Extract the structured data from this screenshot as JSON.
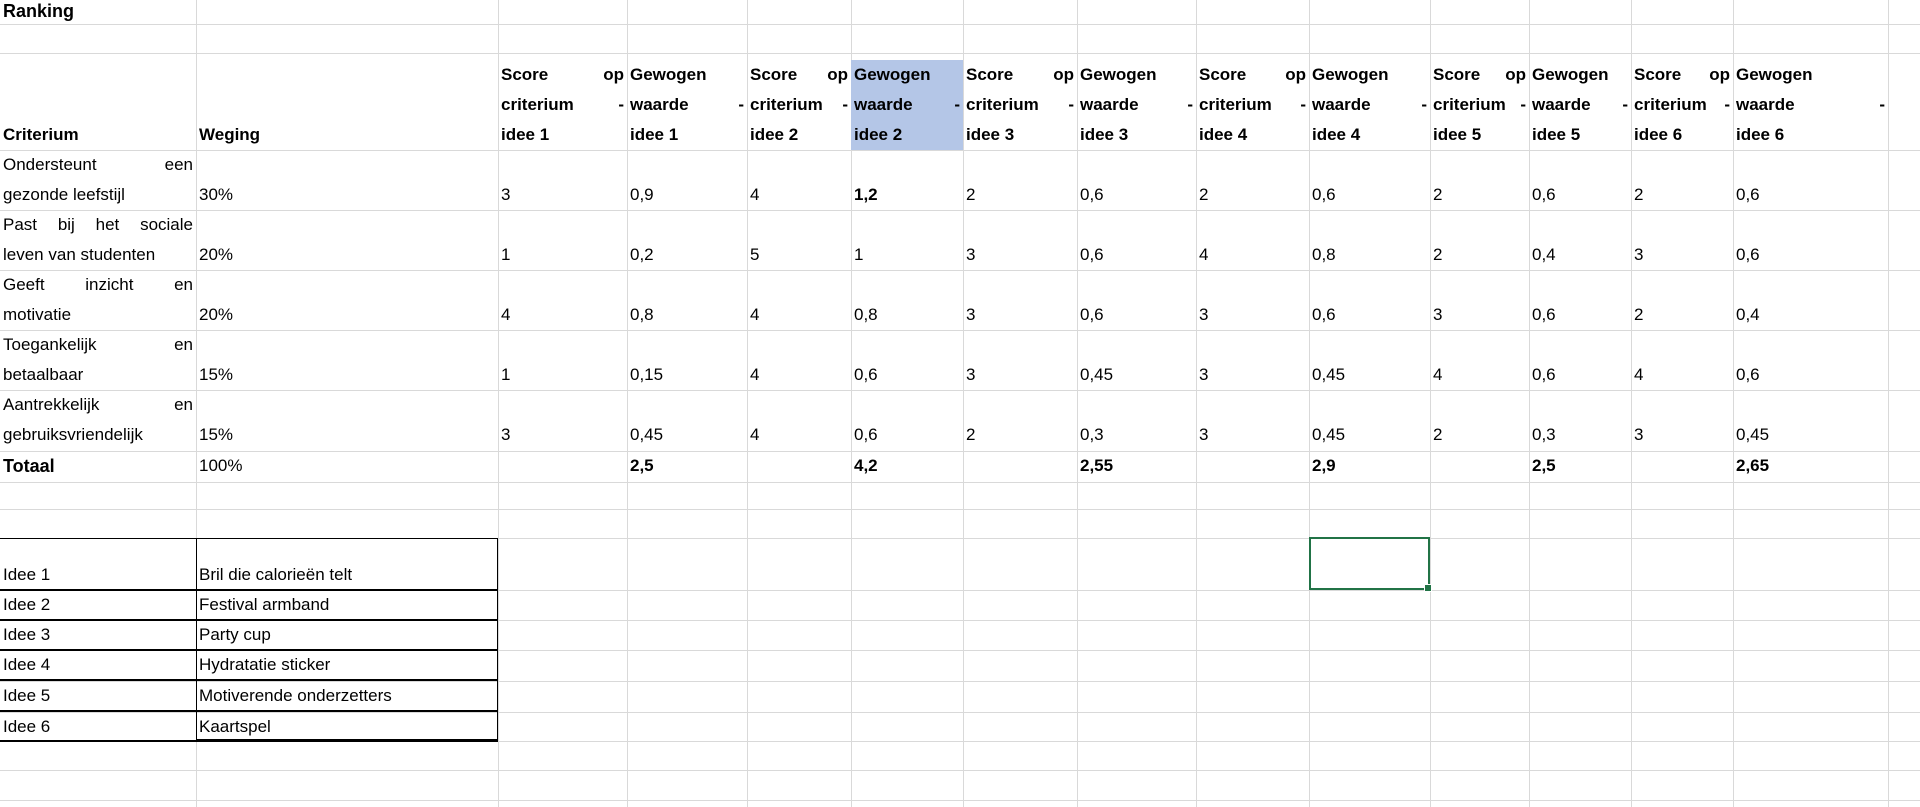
{
  "title": "Ranking",
  "columns": {
    "criterium": "Criterium",
    "weging": "Weging",
    "ideas": [
      {
        "score_header": "Score op criterium - idee 1",
        "weighted_header": "Gewogen waarde - idee 1"
      },
      {
        "score_header": "Score op criterium - idee 2",
        "weighted_header": "Gewogen waarde - idee 2"
      },
      {
        "score_header": "Score op criterium - idee 3",
        "weighted_header": "Gewogen waarde - idee 3"
      },
      {
        "score_header": "Score op criterium - idee 4",
        "weighted_header": "Gewogen waarde - idee 4"
      },
      {
        "score_header": "Score op criterium - idee 5",
        "weighted_header": "Gewogen waarde - idee 5"
      },
      {
        "score_header": "Score op criterium - idee 6",
        "weighted_header": "Gewogen waarde - idee 6"
      }
    ]
  },
  "rows": [
    {
      "criterium_l1": "Ondersteunt een",
      "criterium_l2": "gezonde leefstijl",
      "weging": "30%",
      "values": [
        "3",
        "0,9",
        "4",
        "1,2",
        "2",
        "0,6",
        "2",
        "0,6",
        "2",
        "0,6",
        "2",
        "0,6"
      ]
    },
    {
      "criterium_l1": "Past bij het sociale",
      "criterium_l2": "leven van studenten",
      "weging": "20%",
      "values": [
        "1",
        "0,2",
        "5",
        "1",
        "3",
        "0,6",
        "4",
        "0,8",
        "2",
        "0,4",
        "3",
        "0,6"
      ]
    },
    {
      "criterium_l1": "Geeft inzicht en",
      "criterium_l2": "motivatie",
      "weging": "20%",
      "values": [
        "4",
        "0,8",
        "4",
        "0,8",
        "3",
        "0,6",
        "3",
        "0,6",
        "3",
        "0,6",
        "2",
        "0,4"
      ]
    },
    {
      "criterium_l1": "Toegankelijk en",
      "criterium_l2": "betaalbaar",
      "weging": "15%",
      "values": [
        "1",
        "0,15",
        "4",
        "0,6",
        "3",
        "0,45",
        "3",
        "0,45",
        "4",
        "0,6",
        "4",
        "0,6"
      ]
    },
    {
      "criterium_l1": "Aantrekkelijk en",
      "criterium_l2": "gebruiksvriendelijk",
      "weging": "15%",
      "values": [
        "3",
        "0,45",
        "4",
        "0,6",
        "2",
        "0,3",
        "3",
        "0,45",
        "2",
        "0,3",
        "3",
        "0,45"
      ]
    }
  ],
  "total": {
    "label": "Totaal",
    "weging": "100%",
    "values": [
      "2,5",
      "4,2",
      "2,55",
      "2,9",
      "2,5",
      "2,65"
    ]
  },
  "legend": [
    {
      "id": "Idee 1",
      "name": "Bril die calorieën telt"
    },
    {
      "id": "Idee 2",
      "name": "Festival armband"
    },
    {
      "id": "Idee 3",
      "name": "Party cup"
    },
    {
      "id": "Idee 4",
      "name": "Hydratatie sticker"
    },
    {
      "id": "Idee 5",
      "name": "Motiverende onderzetters"
    },
    {
      "id": "Idee 6",
      "name": "Kaartspel"
    }
  ],
  "colors": {
    "gridline": "#d9d9d9",
    "header_highlight": "#b4c6e7",
    "selection": "#217346"
  }
}
